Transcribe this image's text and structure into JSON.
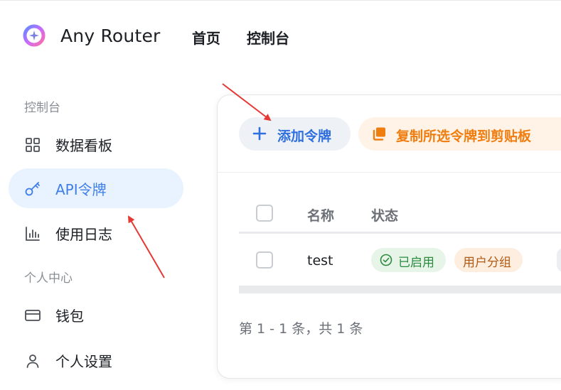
{
  "header": {
    "brand": "Any Router",
    "nav": [
      {
        "label": "首页"
      },
      {
        "label": "控制台"
      }
    ]
  },
  "sidebar": {
    "sections": [
      {
        "title": "控制台",
        "items": [
          {
            "label": "数据看板",
            "icon": "grid-icon",
            "active": false
          },
          {
            "label": "API令牌",
            "icon": "key-icon",
            "active": true
          },
          {
            "label": "使用日志",
            "icon": "bar-chart-icon",
            "active": false
          }
        ]
      },
      {
        "title": "个人中心",
        "items": [
          {
            "label": "钱包",
            "icon": "wallet-icon",
            "active": false
          },
          {
            "label": "个人设置",
            "icon": "user-icon",
            "active": false
          }
        ]
      }
    ]
  },
  "toolbar": {
    "add_label": "添加令牌",
    "copy_label": "复制所选令牌到剪贴板"
  },
  "table": {
    "columns": [
      "名称",
      "状态"
    ],
    "rows": [
      {
        "name": "test",
        "status": "已启用",
        "group": "用户分组"
      }
    ]
  },
  "pagination": {
    "text": "第 1 - 1 条，共 1 条"
  },
  "colors": {
    "accent": "#3f7ee8",
    "active_bg": "#e8f3ff",
    "copy_accent": "#f07d10",
    "status_green": "#2b8a3e",
    "annotation_red": "#e53935"
  }
}
